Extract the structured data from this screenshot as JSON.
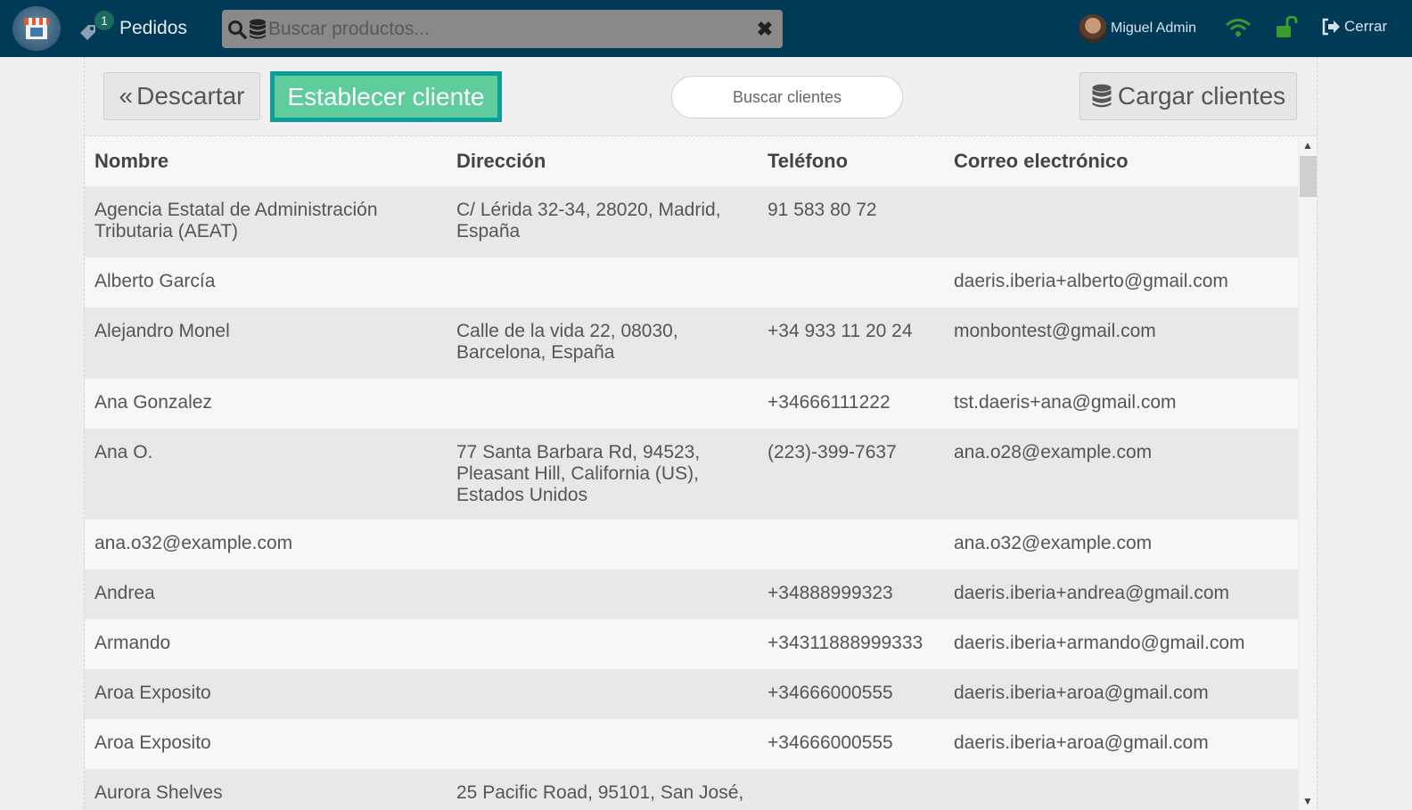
{
  "topbar": {
    "orders_label": "Pedidos",
    "orders_count": "1",
    "search_placeholder": "Buscar productos...",
    "user_name": "Miguel Admin",
    "logout_label": "Cerrar",
    "colors": {
      "bar": "#013a57",
      "wifi": "#3a9c2e",
      "lock": "#3a9c2e"
    }
  },
  "toolbar": {
    "discard_label": "Descartar",
    "set_client_label": "Establecer cliente",
    "client_search_placeholder": "Buscar clientes",
    "load_clients_label": "Cargar clientes",
    "colors": {
      "set_client_bg": "#5fcc9c",
      "set_client_border": "#0d9e9a"
    }
  },
  "table": {
    "headers": [
      "Nombre",
      "Dirección",
      "Teléfono",
      "Correo electrónico"
    ],
    "rows": [
      {
        "name": "Agencia Estatal de Administración Tributaria (AEAT)",
        "address": "C/ Lérida 32-34, 28020, Madrid, España",
        "phone": "91 583 80 72",
        "email": ""
      },
      {
        "name": "Alberto García",
        "address": "",
        "phone": "",
        "email": "daeris.iberia+alberto@gmail.com"
      },
      {
        "name": "Alejandro Monel",
        "address": "Calle de la vida 22, 08030, Barcelona, España",
        "phone": "+34 933 11 20 24",
        "email": "monbontest@gmail.com"
      },
      {
        "name": "Ana Gonzalez",
        "address": "",
        "phone": "+34666111222",
        "email": "tst.daeris+ana@gmail.com"
      },
      {
        "name": "Ana O.",
        "address": "77 Santa Barbara Rd, 94523, Pleasant Hill, California (US), Estados Unidos",
        "phone": "(223)-399-7637",
        "email": "ana.o28@example.com"
      },
      {
        "name": "ana.o32@example.com",
        "address": "",
        "phone": "",
        "email": "ana.o32@example.com"
      },
      {
        "name": "Andrea",
        "address": "",
        "phone": "+34888999323",
        "email": "daeris.iberia+andrea@gmail.com"
      },
      {
        "name": "Armando",
        "address": "",
        "phone": "+34311888999333",
        "email": "daeris.iberia+armando@gmail.com"
      },
      {
        "name": "Aroa Exposito",
        "address": "",
        "phone": "+34666000555",
        "email": "daeris.iberia+aroa@gmail.com"
      },
      {
        "name": "Aroa Exposito",
        "address": "",
        "phone": "+34666000555",
        "email": "daeris.iberia+aroa@gmail.com"
      },
      {
        "name": "Aurora Shelves",
        "address": "25 Pacific Road, 95101, San José,",
        "phone": "",
        "email": ""
      }
    ]
  }
}
